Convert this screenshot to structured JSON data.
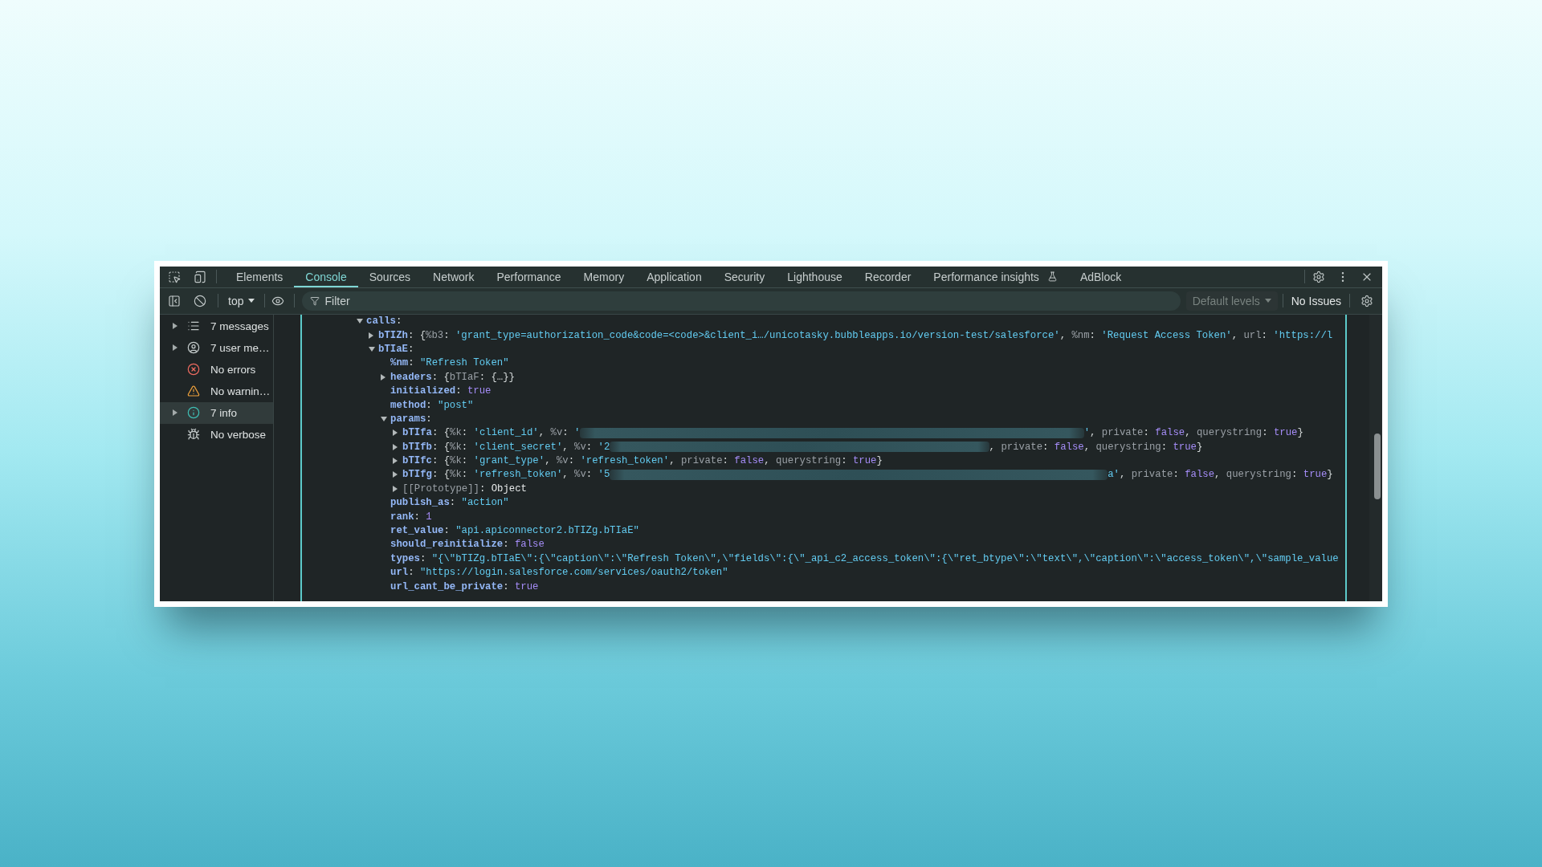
{
  "tab_bar": {
    "tabs": [
      {
        "label": "Elements",
        "selected": false,
        "experimental": false
      },
      {
        "label": "Console",
        "selected": true,
        "experimental": false
      },
      {
        "label": "Sources",
        "selected": false,
        "experimental": false
      },
      {
        "label": "Network",
        "selected": false,
        "experimental": false
      },
      {
        "label": "Performance",
        "selected": false,
        "experimental": false
      },
      {
        "label": "Memory",
        "selected": false,
        "experimental": false
      },
      {
        "label": "Application",
        "selected": false,
        "experimental": false
      },
      {
        "label": "Security",
        "selected": false,
        "experimental": false
      },
      {
        "label": "Lighthouse",
        "selected": false,
        "experimental": false
      },
      {
        "label": "Recorder",
        "selected": false,
        "experimental": false
      },
      {
        "label": "Performance insights",
        "selected": false,
        "experimental": true
      },
      {
        "label": "AdBlock",
        "selected": false,
        "experimental": false
      }
    ]
  },
  "console_toolbar": {
    "context": "top",
    "filter": {
      "placeholder": "Filter"
    },
    "levels": {
      "label": "Default levels",
      "disabled": true
    },
    "issues": "No Issues"
  },
  "sidebar": {
    "items": [
      {
        "label": "7 messages",
        "kind": "messages",
        "expanded": false,
        "selected": false
      },
      {
        "label": "7 user me…",
        "kind": "user",
        "expanded": false,
        "selected": false
      },
      {
        "label": "No errors",
        "kind": "errors",
        "selected": false
      },
      {
        "label": "No warnin…",
        "kind": "warnings",
        "selected": false
      },
      {
        "label": "7 info",
        "kind": "info",
        "expanded": false,
        "selected": true
      },
      {
        "label": "No verbose",
        "kind": "verbose",
        "selected": false
      }
    ]
  },
  "console": {
    "tree": [
      {
        "tokens": [
          {
            "kind": "key",
            "text": "calls"
          },
          {
            "kind": "punct",
            "text": ":"
          }
        ],
        "expanded": true,
        "children": [
          {
            "tokens": [
              {
                "kind": "key",
                "text": "bTIZh"
              },
              {
                "kind": "punct",
                "text": ": {"
              },
              {
                "kind": "dim",
                "text": "%b3"
              },
              {
                "kind": "punct",
                "text": ": "
              },
              {
                "kind": "string",
                "text": "'grant_type=authorization_code&code=<code>&client_i…/unicotasky.bubbleapps.io/version-test/salesforce'"
              },
              {
                "kind": "punct",
                "text": ", "
              },
              {
                "kind": "dim",
                "text": "%nm"
              },
              {
                "kind": "punct",
                "text": ": "
              },
              {
                "kind": "string",
                "text": "'Request Access Token'"
              },
              {
                "kind": "punct",
                "text": ", "
              },
              {
                "kind": "dim",
                "text": "url"
              },
              {
                "kind": "punct",
                "text": ": "
              },
              {
                "kind": "string",
                "text": "'https://l"
              }
            ],
            "expanded": false
          },
          {
            "tokens": [
              {
                "kind": "key",
                "text": "bTIaE"
              },
              {
                "kind": "punct",
                "text": ":"
              }
            ],
            "expanded": true,
            "children": [
              {
                "tokens": [
                  {
                    "kind": "key",
                    "text": "%nm"
                  },
                  {
                    "kind": "punct",
                    "text": ": "
                  },
                  {
                    "kind": "string",
                    "text": "\"Refresh Token\""
                  }
                ]
              },
              {
                "tokens": [
                  {
                    "kind": "key",
                    "text": "headers"
                  },
                  {
                    "kind": "punct",
                    "text": ": {"
                  },
                  {
                    "kind": "dim",
                    "text": "bTIaF"
                  },
                  {
                    "kind": "punct",
                    "text": ": {…}}"
                  }
                ],
                "expanded": false
              },
              {
                "tokens": [
                  {
                    "kind": "key",
                    "text": "initialized"
                  },
                  {
                    "kind": "punct",
                    "text": ": "
                  },
                  {
                    "kind": "literal",
                    "text": "true"
                  }
                ]
              },
              {
                "tokens": [
                  {
                    "kind": "key",
                    "text": "method"
                  },
                  {
                    "kind": "punct",
                    "text": ": "
                  },
                  {
                    "kind": "string",
                    "text": "\"post\""
                  }
                ]
              },
              {
                "tokens": [
                  {
                    "kind": "key",
                    "text": "params"
                  },
                  {
                    "kind": "punct",
                    "text": ":"
                  }
                ],
                "expanded": true,
                "children": [
                  {
                    "tokens": [
                      {
                        "kind": "key",
                        "text": "bTIfa"
                      },
                      {
                        "kind": "punct",
                        "text": ": {"
                      },
                      {
                        "kind": "dim",
                        "text": "%k"
                      },
                      {
                        "kind": "punct",
                        "text": ": "
                      },
                      {
                        "kind": "string",
                        "text": "'client_id'"
                      },
                      {
                        "kind": "punct",
                        "text": ", "
                      },
                      {
                        "kind": "dim",
                        "text": "%v"
                      },
                      {
                        "kind": "punct",
                        "text": ": "
                      },
                      {
                        "kind": "string",
                        "text": "'"
                      },
                      {
                        "kind": "redacted"
                      },
                      {
                        "kind": "string",
                        "text": "'"
                      },
                      {
                        "kind": "punct",
                        "text": ", "
                      },
                      {
                        "kind": "dim",
                        "text": "private"
                      },
                      {
                        "kind": "punct",
                        "text": ": "
                      },
                      {
                        "kind": "literal",
                        "text": "false"
                      },
                      {
                        "kind": "punct",
                        "text": ", "
                      },
                      {
                        "kind": "dim",
                        "text": "querystring"
                      },
                      {
                        "kind": "punct",
                        "text": ": "
                      },
                      {
                        "kind": "literal",
                        "text": "true"
                      },
                      {
                        "kind": "punct",
                        "text": "}"
                      }
                    ],
                    "expanded": false
                  },
                  {
                    "tokens": [
                      {
                        "kind": "key",
                        "text": "bTIfb"
                      },
                      {
                        "kind": "punct",
                        "text": ": {"
                      },
                      {
                        "kind": "dim",
                        "text": "%k"
                      },
                      {
                        "kind": "punct",
                        "text": ": "
                      },
                      {
                        "kind": "string",
                        "text": "'client_secret'"
                      },
                      {
                        "kind": "punct",
                        "text": ", "
                      },
                      {
                        "kind": "dim",
                        "text": "%v"
                      },
                      {
                        "kind": "punct",
                        "text": ": "
                      },
                      {
                        "kind": "string",
                        "text": "'2"
                      },
                      {
                        "kind": "redacted"
                      },
                      {
                        "kind": "punct",
                        "text": ", "
                      },
                      {
                        "kind": "dim",
                        "text": "private"
                      },
                      {
                        "kind": "punct",
                        "text": ": "
                      },
                      {
                        "kind": "literal",
                        "text": "false"
                      },
                      {
                        "kind": "punct",
                        "text": ", "
                      },
                      {
                        "kind": "dim",
                        "text": "querystring"
                      },
                      {
                        "kind": "punct",
                        "text": ": "
                      },
                      {
                        "kind": "literal",
                        "text": "true"
                      },
                      {
                        "kind": "punct",
                        "text": "}"
                      }
                    ],
                    "expanded": false
                  },
                  {
                    "tokens": [
                      {
                        "kind": "key",
                        "text": "bTIfc"
                      },
                      {
                        "kind": "punct",
                        "text": ": {"
                      },
                      {
                        "kind": "dim",
                        "text": "%k"
                      },
                      {
                        "kind": "punct",
                        "text": ": "
                      },
                      {
                        "kind": "string",
                        "text": "'grant_type'"
                      },
                      {
                        "kind": "punct",
                        "text": ", "
                      },
                      {
                        "kind": "dim",
                        "text": "%v"
                      },
                      {
                        "kind": "punct",
                        "text": ": "
                      },
                      {
                        "kind": "string",
                        "text": "'refresh_token'"
                      },
                      {
                        "kind": "punct",
                        "text": ", "
                      },
                      {
                        "kind": "dim",
                        "text": "private"
                      },
                      {
                        "kind": "punct",
                        "text": ": "
                      },
                      {
                        "kind": "literal",
                        "text": "false"
                      },
                      {
                        "kind": "punct",
                        "text": ", "
                      },
                      {
                        "kind": "dim",
                        "text": "querystring"
                      },
                      {
                        "kind": "punct",
                        "text": ": "
                      },
                      {
                        "kind": "literal",
                        "text": "true"
                      },
                      {
                        "kind": "punct",
                        "text": "}"
                      }
                    ],
                    "expanded": false
                  },
                  {
                    "tokens": [
                      {
                        "kind": "key",
                        "text": "bTIfg"
                      },
                      {
                        "kind": "punct",
                        "text": ": {"
                      },
                      {
                        "kind": "dim",
                        "text": "%k"
                      },
                      {
                        "kind": "punct",
                        "text": ": "
                      },
                      {
                        "kind": "string",
                        "text": "'refresh_token'"
                      },
                      {
                        "kind": "punct",
                        "text": ", "
                      },
                      {
                        "kind": "dim",
                        "text": "%v"
                      },
                      {
                        "kind": "punct",
                        "text": ": "
                      },
                      {
                        "kind": "string",
                        "text": "'5"
                      },
                      {
                        "kind": "redacted"
                      },
                      {
                        "kind": "string",
                        "text": "a'"
                      },
                      {
                        "kind": "punct",
                        "text": ", "
                      },
                      {
                        "kind": "dim",
                        "text": "private"
                      },
                      {
                        "kind": "punct",
                        "text": ": "
                      },
                      {
                        "kind": "literal",
                        "text": "false"
                      },
                      {
                        "kind": "punct",
                        "text": ", "
                      },
                      {
                        "kind": "dim",
                        "text": "querystring"
                      },
                      {
                        "kind": "punct",
                        "text": ": "
                      },
                      {
                        "kind": "literal",
                        "text": "true"
                      },
                      {
                        "kind": "punct",
                        "text": "}"
                      }
                    ],
                    "expanded": false
                  },
                  {
                    "tokens": [
                      {
                        "kind": "dim",
                        "text": "[[Prototype]]"
                      },
                      {
                        "kind": "punct",
                        "text": ": "
                      },
                      {
                        "kind": "plain",
                        "text": "Object"
                      }
                    ],
                    "expanded": false
                  }
                ]
              },
              {
                "tokens": [
                  {
                    "kind": "key",
                    "text": "publish_as"
                  },
                  {
                    "kind": "punct",
                    "text": ": "
                  },
                  {
                    "kind": "string",
                    "text": "\"action\""
                  }
                ]
              },
              {
                "tokens": [
                  {
                    "kind": "key",
                    "text": "rank"
                  },
                  {
                    "kind": "punct",
                    "text": ": "
                  },
                  {
                    "kind": "literal",
                    "text": "1"
                  }
                ]
              },
              {
                "tokens": [
                  {
                    "kind": "key",
                    "text": "ret_value"
                  },
                  {
                    "kind": "punct",
                    "text": ": "
                  },
                  {
                    "kind": "string",
                    "text": "\"api.apiconnector2.bTIZg.bTIaE\""
                  }
                ]
              },
              {
                "tokens": [
                  {
                    "kind": "key",
                    "text": "should_reinitialize"
                  },
                  {
                    "kind": "punct",
                    "text": ": "
                  },
                  {
                    "kind": "literal",
                    "text": "false"
                  }
                ]
              },
              {
                "tokens": [
                  {
                    "kind": "key",
                    "text": "types"
                  },
                  {
                    "kind": "punct",
                    "text": ": "
                  },
                  {
                    "kind": "string",
                    "text": "\"{\\\"bTIZg.bTIaE\\\":{\\\"caption\\\":\\\"Refresh Token\\\",\\\"fields\\\":{\\\"_api_c2_access_token\\\":{\\\"ret_btype\\\":\\\"text\\\",\\\"caption\\\":\\\"access_token\\\",\\\"sample_value"
                  }
                ]
              },
              {
                "tokens": [
                  {
                    "kind": "key",
                    "text": "url"
                  },
                  {
                    "kind": "punct",
                    "text": ": "
                  },
                  {
                    "kind": "string",
                    "text": "\"https://login.salesforce.com/services/oauth2/token\""
                  }
                ]
              },
              {
                "tokens": [
                  {
                    "kind": "key",
                    "text": "url_cant_be_private"
                  },
                  {
                    "kind": "punct",
                    "text": ": "
                  },
                  {
                    "kind": "literal",
                    "text": "true"
                  }
                ]
              }
            ]
          }
        ]
      }
    ]
  }
}
